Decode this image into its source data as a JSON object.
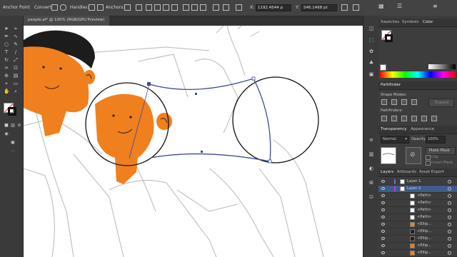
{
  "control_bar": {
    "anchor_point_label": "Anchor Point",
    "convert_label": "Convert:",
    "handles_label": "Handles:",
    "anchors_label": "Anchors:",
    "x_label": "X:",
    "x_value": "1192.4544 p",
    "y_label": "Y:",
    "y_value": "546.1468 pt"
  },
  "document_tab": {
    "title": "people.ai* @ 100% (RGB/GPU Preview)"
  },
  "color_panel": {
    "tabs": [
      "Swatches",
      "Symbols",
      "Color"
    ],
    "active_tab": "Color"
  },
  "pathfinder_panel": {
    "title": "Pathfinder",
    "shape_modes_label": "Shape Modes:",
    "expand_label": "Expand",
    "pathfinders_label": "Pathfinders:"
  },
  "transparency_panel": {
    "tabs": [
      "Transparency",
      "Appearance"
    ],
    "blend_mode": "Normal",
    "opacity_label": "Opacity:",
    "opacity_value": "100%",
    "make_mask_label": "Make Mask",
    "clip_label": "Clip",
    "invert_mask_label": "Invert Mask"
  },
  "layers_panel": {
    "tabs": [
      "Layers",
      "Artboards",
      "Asset Export"
    ],
    "rows": [
      "Layer 1",
      "Layer 2",
      "<Path>",
      "<Path>",
      "<Path>",
      "<Path>",
      "<Ellip...",
      "<Ellip...",
      "<Ellip...",
      "<Ellip...",
      "<Ellip..."
    ]
  },
  "colors": {
    "ui_dark": "#323232",
    "canvas": "#ffffff",
    "character_orange": "#f07f1e",
    "hair": "#1c1c1c",
    "selection_blue": "#3b4a9a"
  }
}
